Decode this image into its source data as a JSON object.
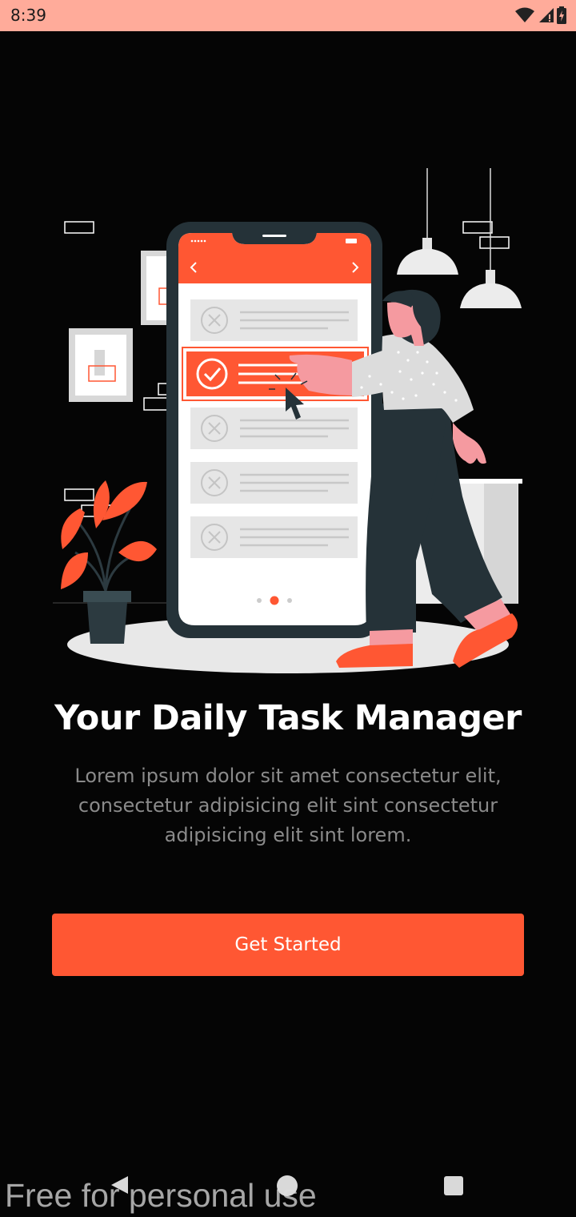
{
  "status_bar": {
    "time": "8:39",
    "icons": [
      "wifi-icon",
      "signal-icon",
      "battery-charging-icon"
    ]
  },
  "illustration": {
    "icons": [
      "check-circle-icon",
      "cancel-circle-icon",
      "cursor-icon",
      "chevron-left-icon",
      "chevron-right-icon"
    ]
  },
  "onboarding": {
    "title": "Your Daily Task Manager",
    "description": "Lorem ipsum dolor sit amet consectetur elit, consectetur adipisicing elit sint consectetur adipisicing elit sint lorem.",
    "button_label": "Get Started"
  },
  "nav_bar": {
    "icons": [
      "back-icon",
      "home-icon",
      "recents-icon"
    ]
  },
  "watermark": "Free for personal use",
  "colors": {
    "accent": "#ff5733",
    "background": "#050505",
    "status_bar": "#ffab9a",
    "text_primary": "#ffffff",
    "text_secondary": "#8a8a8a"
  }
}
